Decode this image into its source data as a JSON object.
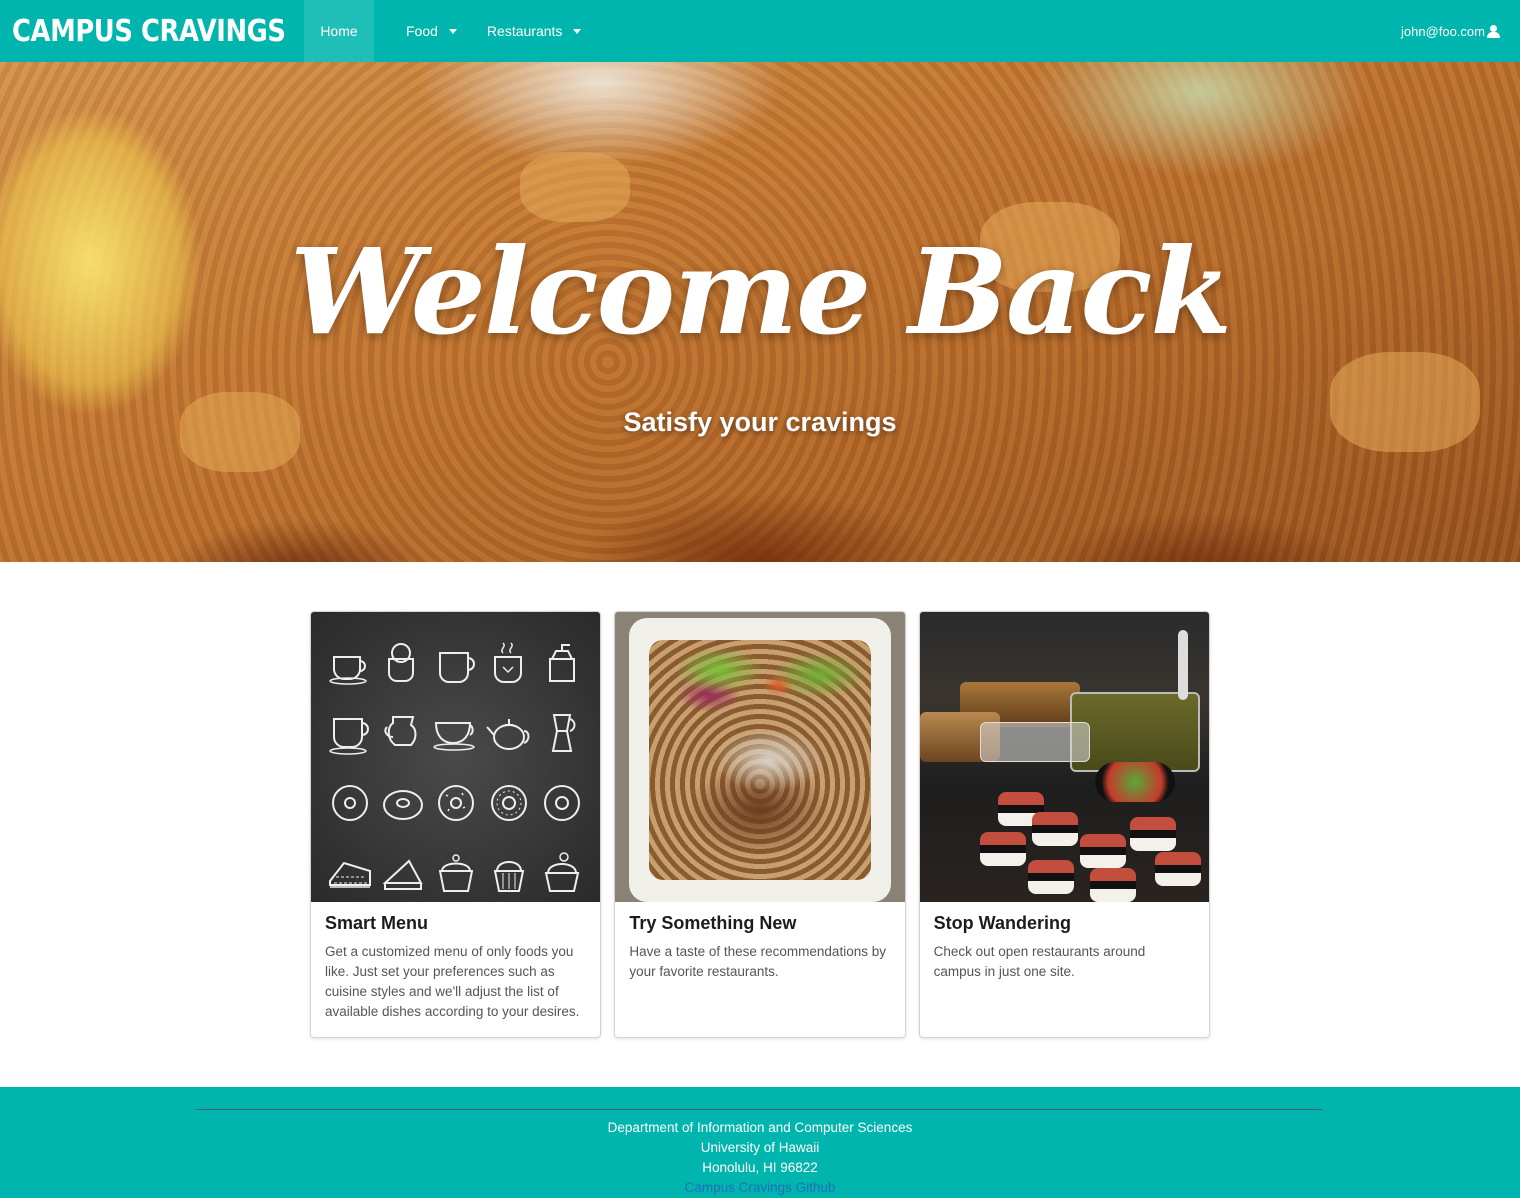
{
  "nav": {
    "brand": "CAMPUS CRAVINGS",
    "home_label": "Home",
    "food_label": "Food",
    "restaurants_label": "Restaurants",
    "user_email": "john@foo.com"
  },
  "hero": {
    "title": "Welcome Back",
    "subtitle": "Satisfy your cravings"
  },
  "cards": [
    {
      "title": "Smart Menu",
      "description": "Get a customized menu of only foods you like. Just set your preferences such as cuisine styles and we'll adjust the list of available dishes according to your desires."
    },
    {
      "title": "Try Something New",
      "description": "Have a taste of these recommendations by your favorite restaurants."
    },
    {
      "title": "Stop Wandering",
      "description": "Check out open restaurants around campus in just one site."
    }
  ],
  "footer": {
    "line1": "Department of Information and Computer Sciences",
    "line2": "University of Hawaii",
    "line3": "Honolulu, HI 96822",
    "link": "Campus Cravings Github"
  },
  "colors": {
    "accent": "#00b5ad",
    "link": "#1e70bf"
  },
  "icons": [
    "caret-down-icon",
    "user-icon"
  ]
}
